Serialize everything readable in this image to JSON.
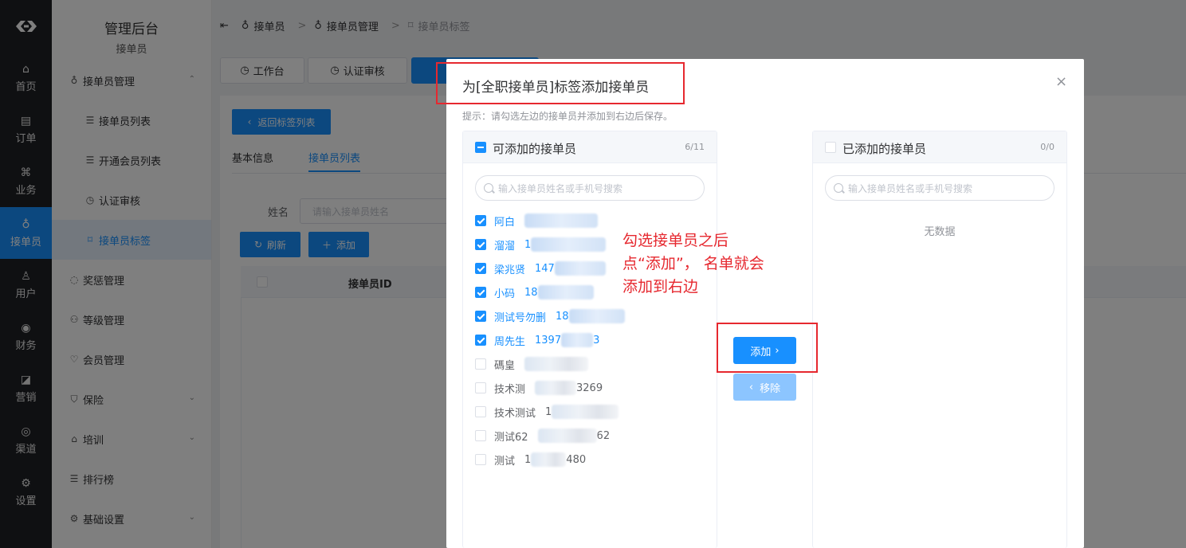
{
  "rail": {
    "items": [
      {
        "label": "首页",
        "icon": "home-icon",
        "glyph": "⌂"
      },
      {
        "label": "订单",
        "icon": "order-icon",
        "glyph": "▤"
      },
      {
        "label": "业务",
        "icon": "apps-icon",
        "glyph": "⌘"
      },
      {
        "label": "接单员",
        "icon": "bicycle-icon",
        "glyph": "♁"
      },
      {
        "label": "用户",
        "icon": "user-icon",
        "glyph": "♙"
      },
      {
        "label": "财务",
        "icon": "money-icon",
        "glyph": "◉"
      },
      {
        "label": "营销",
        "icon": "chart-icon",
        "glyph": "◪"
      },
      {
        "label": "渠道",
        "icon": "compass-icon",
        "glyph": "◎"
      },
      {
        "label": "设置",
        "icon": "settings-icon",
        "glyph": "⚙"
      }
    ]
  },
  "sidebar": {
    "title": "管理后台",
    "subtitle": "接单员",
    "items": [
      {
        "label": "接单员管理",
        "glyph": "♁",
        "chevron": "⌃"
      },
      {
        "label": "接单员列表",
        "glyph": "☰"
      },
      {
        "label": "开通会员列表",
        "glyph": "☰"
      },
      {
        "label": "认证审核",
        "glyph": "◷"
      },
      {
        "label": "接单员标签",
        "glyph": "⌑"
      },
      {
        "label": "奖惩管理",
        "glyph": "◌"
      },
      {
        "label": "等级管理",
        "glyph": "⚇"
      },
      {
        "label": "会员管理",
        "glyph": "♡"
      },
      {
        "label": "保险",
        "glyph": "⛉",
        "chevron": "⌄"
      },
      {
        "label": "培训",
        "glyph": "⌂",
        "chevron": "⌄"
      },
      {
        "label": "排行榜",
        "glyph": "☰"
      },
      {
        "label": "基础设置",
        "glyph": "⚙",
        "chevron": "⌄"
      }
    ]
  },
  "breadcrumb": {
    "toggle": "⇤",
    "items": [
      "接单员",
      "接单员管理",
      "接单员标签"
    ]
  },
  "worktabs": [
    {
      "label": "工作台",
      "glyph": "◷"
    },
    {
      "label": "认证审核",
      "glyph": "◷"
    }
  ],
  "main": {
    "back_label": "返回标签列表",
    "tabs": [
      "基本信息",
      "接单员列表"
    ],
    "filter_label": "姓名",
    "filter_placeholder": "请输入接单员姓名",
    "refresh_label": "刷新",
    "add_label": "添加",
    "table_header": "接单员ID"
  },
  "dialog": {
    "title": "为[全职接单员]标签添加接单员",
    "close": "×",
    "hint": "提示：请勾选左边的接单员并添加到右边后保存。",
    "left": {
      "title": "可添加的接单员",
      "count": "6/11",
      "search_placeholder": "输入接单员姓名或手机号搜索",
      "items": [
        {
          "name": "阿白",
          "phone": "",
          "checked": true
        },
        {
          "name": "溜溜",
          "phone": "1",
          "checked": true
        },
        {
          "name": "梁兆贤",
          "phone": "147",
          "checked": true
        },
        {
          "name": "小码",
          "phone": "18",
          "checked": true
        },
        {
          "name": "测试号勿删",
          "phone": "18",
          "checked": true
        },
        {
          "name": "周先生",
          "phone": "1397",
          "tail": "3",
          "checked": true
        },
        {
          "name": "碼皇",
          "phone": "",
          "checked": false
        },
        {
          "name": "技术测",
          "phone": "",
          "tail": "3269",
          "checked": false
        },
        {
          "name": "技术测试",
          "phone": "1",
          "checked": false
        },
        {
          "name": "测试62",
          "phone": "",
          "tail": "62",
          "checked": false
        },
        {
          "name": "测试",
          "phone": "1",
          "tail": "480",
          "checked": false
        }
      ]
    },
    "right": {
      "title": "已添加的接单员",
      "count": "0/0",
      "search_placeholder": "输入接单员姓名或手机号搜索",
      "empty_text": "无数据"
    },
    "add_button": "添加",
    "remove_button": "移除"
  },
  "annotation": {
    "lines": [
      "勾选接单员之后",
      "点“添加”， 名单就会",
      "添加到右边"
    ],
    "color": "#e6282f"
  },
  "colors": {
    "primary": "#1890ff",
    "rail": "#1f2024"
  }
}
